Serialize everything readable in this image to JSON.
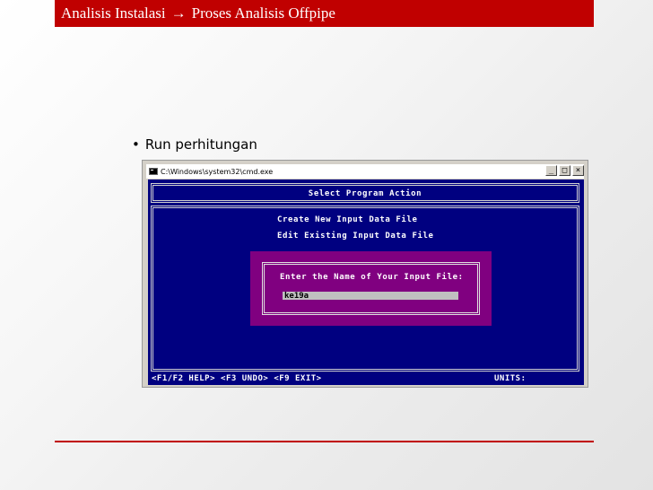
{
  "slide": {
    "title_part1": "Analisis Instalasi",
    "arrow": "→",
    "title_part2": "Proses Analisis Offpipe",
    "bullet_text": "Run perhitungan",
    "accent_color": "#c00000"
  },
  "cmd_window": {
    "title": "C:\\Windows\\system32\\cmd.exe",
    "min_label": "_",
    "max_label": "□",
    "close_label": "×"
  },
  "console": {
    "screen_title": "Select Program Action",
    "menu": [
      "Create New Input Data File",
      "Edit Existing Input Data File"
    ],
    "dialog": {
      "label": "Enter the Name of Your Input File:",
      "input_value": "ke19a"
    },
    "status": {
      "keys": [
        "<F1/F2 HELP>",
        "<F3 UNDO>",
        "<F9 EXIT>"
      ],
      "units": "UNITS:"
    },
    "background_color": "#000080",
    "dialog_color": "#800080"
  }
}
